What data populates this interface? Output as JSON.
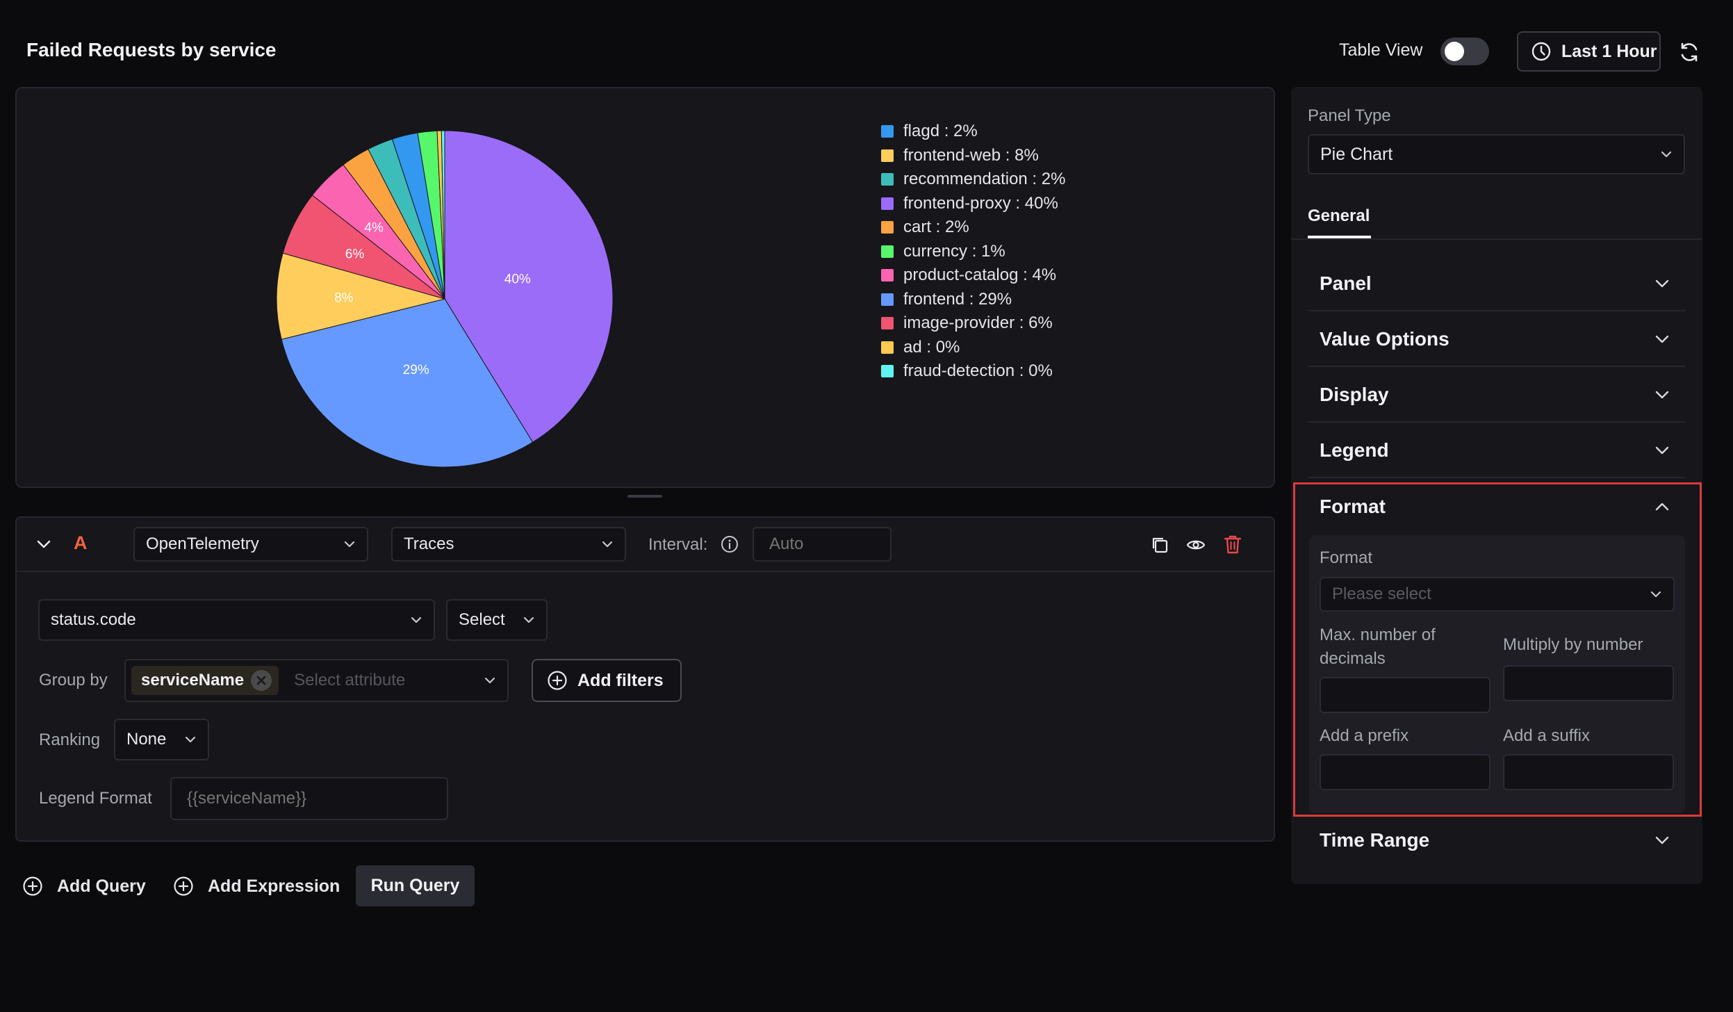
{
  "header": {
    "title": "Failed Requests by service",
    "table_view_label": "Table View",
    "table_view_enabled": false,
    "time_range_label": "Last 1 Hour"
  },
  "chart_data": {
    "type": "pie",
    "slices": [
      {
        "label": "frontend-proxy",
        "value": 40,
        "display": "40%",
        "color": "#9b6cf7"
      },
      {
        "label": "frontend",
        "value": 29,
        "display": "29%",
        "color": "#6699ff"
      },
      {
        "label": "frontend-web",
        "value": 8,
        "display": "8%",
        "color": "#ffcd5c"
      },
      {
        "label": "image-provider",
        "value": 6,
        "display": "6%",
        "color": "#f05470"
      },
      {
        "label": "product-catalog",
        "value": 4,
        "display": "4%",
        "color": "#fb64b1"
      },
      {
        "label": "cart",
        "value": 2.7,
        "display": "",
        "color": "#fba241"
      },
      {
        "label": "recommendation",
        "value": 2.4,
        "display": "",
        "color": "#3dbdba"
      },
      {
        "label": "flagd",
        "value": 2.4,
        "display": "",
        "color": "#3398f0"
      },
      {
        "label": "currency",
        "value": 1.8,
        "display": "",
        "color": "#56f76a"
      },
      {
        "label": "ad",
        "value": 0.4,
        "display": "",
        "color": "#ffca4f"
      },
      {
        "label": "fraud-detection",
        "value": 0.3,
        "display": "",
        "color": "#5ff4f0"
      }
    ],
    "legend": [
      {
        "text": "flagd : 2%",
        "color": "#3398f0"
      },
      {
        "text": "frontend-web : 8%",
        "color": "#ffcd5c"
      },
      {
        "text": "recommendation : 2%",
        "color": "#3dbdba"
      },
      {
        "text": "frontend-proxy : 40%",
        "color": "#9b6cf7"
      },
      {
        "text": "cart : 2%",
        "color": "#fba241"
      },
      {
        "text": "currency : 1%",
        "color": "#56f76a"
      },
      {
        "text": "product-catalog : 4%",
        "color": "#fb64b1"
      },
      {
        "text": "frontend : 29%",
        "color": "#6699ff"
      },
      {
        "text": "image-provider : 6%",
        "color": "#f05470"
      },
      {
        "text": "ad : 0%",
        "color": "#ffca4f"
      },
      {
        "text": "fraud-detection : 0%",
        "color": "#5ff4f0"
      }
    ],
    "legend_placement": "right"
  },
  "query": {
    "name": "A",
    "datasource": "OpenTelemetry",
    "signal": "Traces",
    "interval_label": "Interval:",
    "interval_placeholder": "Auto",
    "aggregate_attribute": "status.code",
    "aggregate_operator": "Select",
    "group_by_label": "Group by",
    "group_by_chip": "serviceName",
    "group_by_placeholder": "Select attribute",
    "add_filters_label": "Add filters",
    "ranking_label": "Ranking",
    "ranking_value": "None",
    "legend_format_label": "Legend Format",
    "legend_format_placeholder": "{{serviceName}}"
  },
  "footer": {
    "add_query": "Add Query",
    "add_expression": "Add Expression",
    "run_query": "Run Query"
  },
  "settings": {
    "panel_type_label": "Panel Type",
    "panel_type_value": "Pie Chart",
    "tab_general": "General",
    "sections": {
      "panel": "Panel",
      "value_options": "Value Options",
      "display": "Display",
      "legend": "Legend",
      "format": "Format",
      "time_range": "Time Range"
    },
    "format": {
      "format_label": "Format",
      "format_placeholder": "Please select",
      "decimals_label": "Max. number of decimals",
      "multiply_label": "Multiply by number",
      "prefix_label": "Add a prefix",
      "suffix_label": "Add a suffix"
    }
  },
  "colors": {
    "background": "#0b0b0e",
    "panel": "#16161b",
    "highlight_border": "#dc3a3a",
    "query_letter": "#f0633f",
    "delete_icon": "#e5484d"
  }
}
